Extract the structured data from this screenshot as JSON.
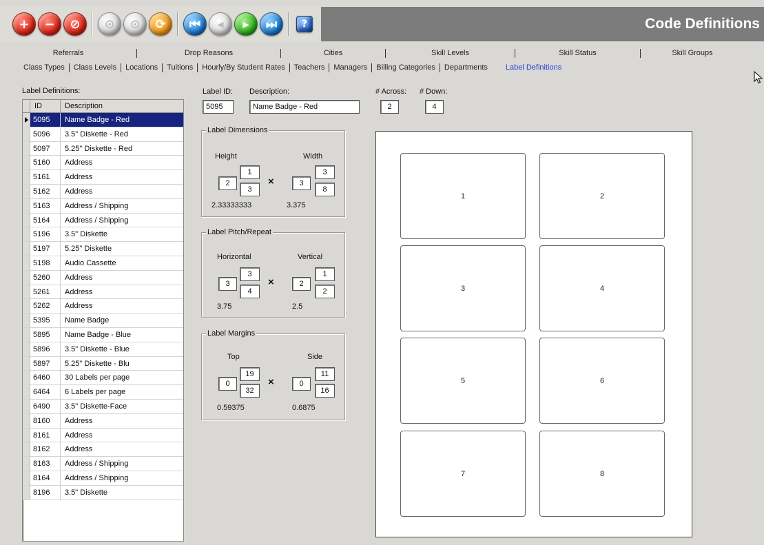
{
  "window": {
    "title": "Code Definitions"
  },
  "toolbar": {
    "buttons": [
      {
        "icon": "add-icon",
        "glyph": "+"
      },
      {
        "icon": "remove-icon",
        "glyph": "−"
      },
      {
        "icon": "cancel-icon",
        "glyph": "⊘"
      },
      {
        "icon": "disabled-icon",
        "glyph": "⊙"
      },
      {
        "icon": "disabled-icon",
        "glyph": "⊙"
      },
      {
        "icon": "refresh-icon",
        "glyph": "⟳"
      },
      {
        "icon": "first-record-icon",
        "glyph": "⏮"
      },
      {
        "icon": "previous-record-icon",
        "glyph": "◂"
      },
      {
        "icon": "next-record-icon",
        "glyph": "▸"
      },
      {
        "icon": "last-record-icon",
        "glyph": "⏭"
      },
      {
        "icon": "help-icon",
        "glyph": "?"
      }
    ]
  },
  "tabs": {
    "back": [
      "Referrals",
      "Drop Reasons",
      "Cities",
      "Skill Levels",
      "Skill Status",
      "Skill Groups"
    ],
    "front": [
      "Class Types",
      "Class Levels",
      "Locations",
      "Tuitions",
      "Hourly/By Student Rates",
      "Teachers",
      "Managers",
      "Billing Categories",
      "Departments",
      "Label Definitions"
    ],
    "active": "Label Definitions"
  },
  "grid": {
    "title": "Label Definitions:",
    "headers": {
      "id": "ID",
      "description": "Description"
    },
    "rows": [
      {
        "id": "5095",
        "desc": "Name Badge - Red"
      },
      {
        "id": "5096",
        "desc": "3.5\" Diskette - Red"
      },
      {
        "id": "5097",
        "desc": "5.25\" Diskette - Red"
      },
      {
        "id": "5160",
        "desc": "Address"
      },
      {
        "id": "5161",
        "desc": "Address"
      },
      {
        "id": "5162",
        "desc": "Address"
      },
      {
        "id": "5163",
        "desc": "Address / Shipping"
      },
      {
        "id": "5164",
        "desc": "Address / Shipping"
      },
      {
        "id": "5196",
        "desc": "3.5\" Diskette"
      },
      {
        "id": "5197",
        "desc": "5.25\" Diskette"
      },
      {
        "id": "5198",
        "desc": "Audio Cassette"
      },
      {
        "id": "5260",
        "desc": "Address"
      },
      {
        "id": "5261",
        "desc": "Address"
      },
      {
        "id": "5262",
        "desc": "Address"
      },
      {
        "id": "5395",
        "desc": "Name Badge"
      },
      {
        "id": "5895",
        "desc": "Name Badge - Blue"
      },
      {
        "id": "5896",
        "desc": "3.5\" Diskette - Blue"
      },
      {
        "id": "5897",
        "desc": "5.25\" Diskette - Blu"
      },
      {
        "id": "6460",
        "desc": "30 Labels per page"
      },
      {
        "id": "6464",
        "desc": "6 Labels per page"
      },
      {
        "id": "6490",
        "desc": "3.5\" Diskette-Face"
      },
      {
        "id": "8160",
        "desc": "Address"
      },
      {
        "id": "8161",
        "desc": "Address"
      },
      {
        "id": "8162",
        "desc": "Address"
      },
      {
        "id": "8163",
        "desc": "Address / Shipping"
      },
      {
        "id": "8164",
        "desc": "Address / Shipping"
      },
      {
        "id": "8196",
        "desc": "3.5\" Diskette"
      }
    ],
    "selected_index": 0
  },
  "form": {
    "label_id_label": "Label ID:",
    "label_id": "5095",
    "description_label": "Description:",
    "description": "Name Badge - Red",
    "across_label": "# Across:",
    "across": "2",
    "down_label": "# Down:",
    "down": "4"
  },
  "dimensions": {
    "title": "Label Dimensions",
    "col1_label": "Height",
    "col2_label": "Width",
    "h_whole": "2",
    "h_num": "1",
    "h_den": "3",
    "h_decimal": "2.33333333",
    "w_whole": "3",
    "w_num": "3",
    "w_den": "8",
    "w_decimal": "3.375",
    "times": "×"
  },
  "pitch": {
    "title": "Label Pitch/Repeat",
    "col1_label": "Horizontal",
    "col2_label": "Vertical",
    "h_whole": "3",
    "h_num": "3",
    "h_den": "4",
    "h_decimal": "3.75",
    "v_whole": "2",
    "v_num": "1",
    "v_den": "2",
    "v_decimal": "2.5",
    "times": "×"
  },
  "margins": {
    "title": "Label Margins",
    "col1_label": "Top",
    "col2_label": "Side",
    "t_whole": "0",
    "t_num": "19",
    "t_den": "32",
    "t_decimal": "0.59375",
    "s_whole": "0",
    "s_num": "11",
    "s_den": "16",
    "s_decimal": "0.6875",
    "times": "×"
  },
  "preview": {
    "labels": [
      "1",
      "2",
      "3",
      "4",
      "5",
      "6",
      "7",
      "8"
    ]
  }
}
